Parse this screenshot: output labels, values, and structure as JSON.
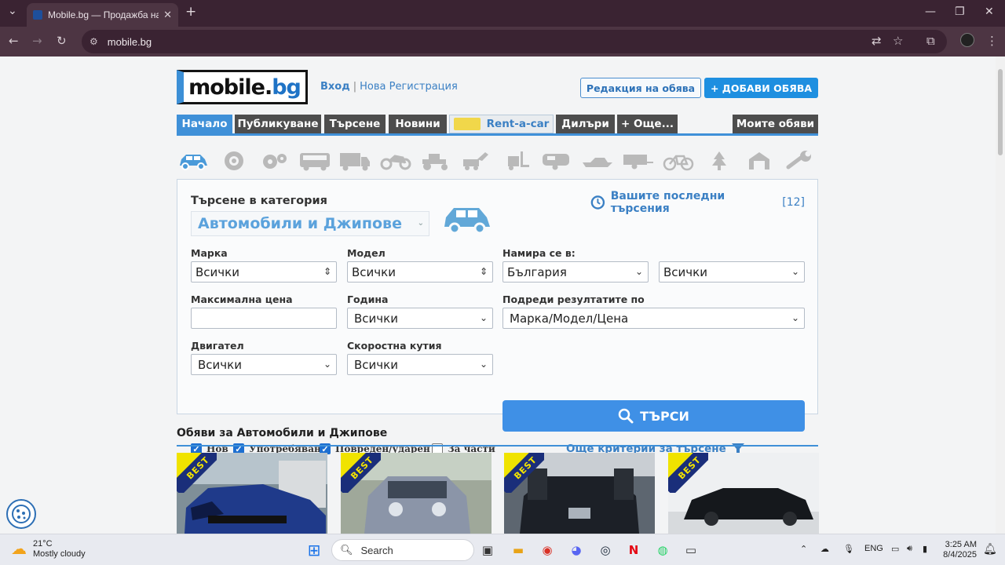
{
  "browser": {
    "tab_title": "Mobile.bg — Продажба на но",
    "new_tab": "+",
    "tab_close": "✕",
    "url": "mobile.bg"
  },
  "header": {
    "logo_main": "mobile.",
    "logo_accent": "bg",
    "login": "Вход",
    "separator": "|",
    "register": "Нова Регистрация",
    "edit_listing": "Редакция на обява",
    "add_listing": "+ ДОБАВИ ОБЯВА"
  },
  "menu": {
    "items": [
      "Начало",
      "Публикуване",
      "Търсене",
      "Новини",
      "Rent-a-car",
      "Дилъри",
      "+ Още...",
      "Моите обяви"
    ]
  },
  "search": {
    "category_heading": "Търсене в категория",
    "category_value": "Автомобили и Джипове",
    "recent_label": "Вашите последни търсения",
    "recent_count": "[12]",
    "brand_label": "Марка",
    "brand_value": "Всички",
    "model_label": "Модел",
    "model_value": "Всички",
    "location_label": "Намира се в:",
    "location_value": "България",
    "location2_value": "Всички",
    "max_price_label": "Максимална цена",
    "max_price_value": "",
    "year_label": "Година",
    "year_value": "Всички",
    "sort_label": "Подреди резултатите по",
    "sort_value": "Марка/Модел/Цена",
    "engine_label": "Двигател",
    "engine_value": "Всички",
    "gearbox_label": "Скоростна кутия",
    "gearbox_value": "Всички",
    "search_button": "ТЪРСИ",
    "checks": [
      {
        "label": "Нов",
        "checked": true
      },
      {
        "label": "Употребяван",
        "checked": true
      },
      {
        "label": "Повреден/ударен",
        "checked": true
      },
      {
        "label": "За части",
        "checked": false
      }
    ],
    "more_criteria": "Още критерии за търсене"
  },
  "listings": {
    "heading": "Обяви за Автомобили и Джипове",
    "badge": "BEST"
  },
  "taskbar": {
    "temp": "21°C",
    "weather": "Mostly cloudy",
    "search": "Search",
    "lang": "ENG",
    "time": "3:25 AM",
    "date": "8/4/2025"
  },
  "colors": {
    "accent": "#3f90d8",
    "menu_dark": "#4d4d4d",
    "primary_button": "#1e8fe0"
  }
}
